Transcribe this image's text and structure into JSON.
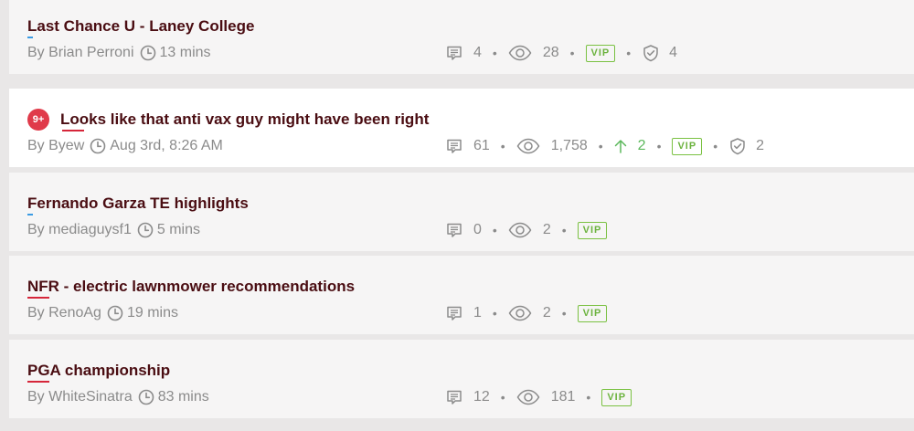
{
  "by_prefix": "By",
  "vip_label": "VIP",
  "threads": [
    {
      "title": "Last Chance U - Laney College",
      "author": "Brian Perroni",
      "time": "13 mins",
      "comments": "4",
      "views": "28",
      "upvotes": null,
      "vip": true,
      "shield": "4",
      "badge": null,
      "underline": "blue"
    },
    {
      "title": "Looks like that anti vax guy might have been right",
      "author": "Byew",
      "time": "Aug 3rd, 8:26 AM",
      "comments": "61",
      "views": "1,758",
      "upvotes": "2",
      "vip": true,
      "shield": "2",
      "badge": "9+",
      "underline": "red"
    },
    {
      "title": "Fernando Garza TE highlights",
      "author": "mediaguysf1",
      "time": "5 mins",
      "comments": "0",
      "views": "2",
      "upvotes": null,
      "vip": true,
      "shield": null,
      "badge": null,
      "underline": "blue"
    },
    {
      "title": "NFR - electric lawnmower recommendations",
      "author": "RenoAg",
      "time": "19 mins",
      "comments": "1",
      "views": "2",
      "upvotes": null,
      "vip": true,
      "shield": null,
      "badge": null,
      "underline": "red"
    },
    {
      "title": "PGA championship",
      "author": "WhiteSinatra",
      "time": "83 mins",
      "comments": "12",
      "views": "181",
      "upvotes": null,
      "vip": true,
      "shield": null,
      "badge": null,
      "underline": "red"
    }
  ],
  "colors": {
    "title": "#4a0d12",
    "meta": "#8b8b8b",
    "badge": "#e03a4a",
    "vip": "#6cb33f",
    "upvote": "#5cb85c",
    "underline_blue": "#3b9be3",
    "underline_red": "#d6263a"
  },
  "icons": {
    "comment": "comment-icon",
    "views": "eye-icon",
    "time": "clock-icon",
    "upvote": "arrow-up-icon",
    "shield": "shield-check-icon"
  }
}
